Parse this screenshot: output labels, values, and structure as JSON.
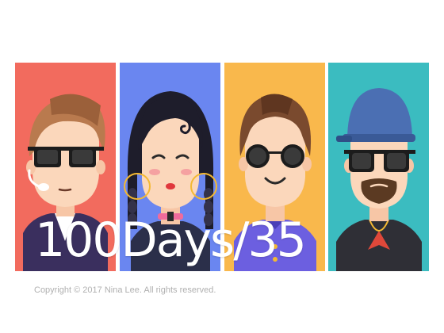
{
  "artwork": {
    "headline": "100Days/35",
    "copyright": "Copyright © 2017 Nina Lee. All rights reserved.",
    "panels": [
      {
        "name": "sunglasses-guy-with-headset",
        "background": "#f26b5e"
      },
      {
        "name": "woman-with-braids-and-hoop-earrings",
        "background": "#6a86f0"
      },
      {
        "name": "man-with-round-sunglasses",
        "background": "#f9b84c"
      },
      {
        "name": "bearded-man-with-cap",
        "background": "#3bbcc0"
      }
    ]
  }
}
